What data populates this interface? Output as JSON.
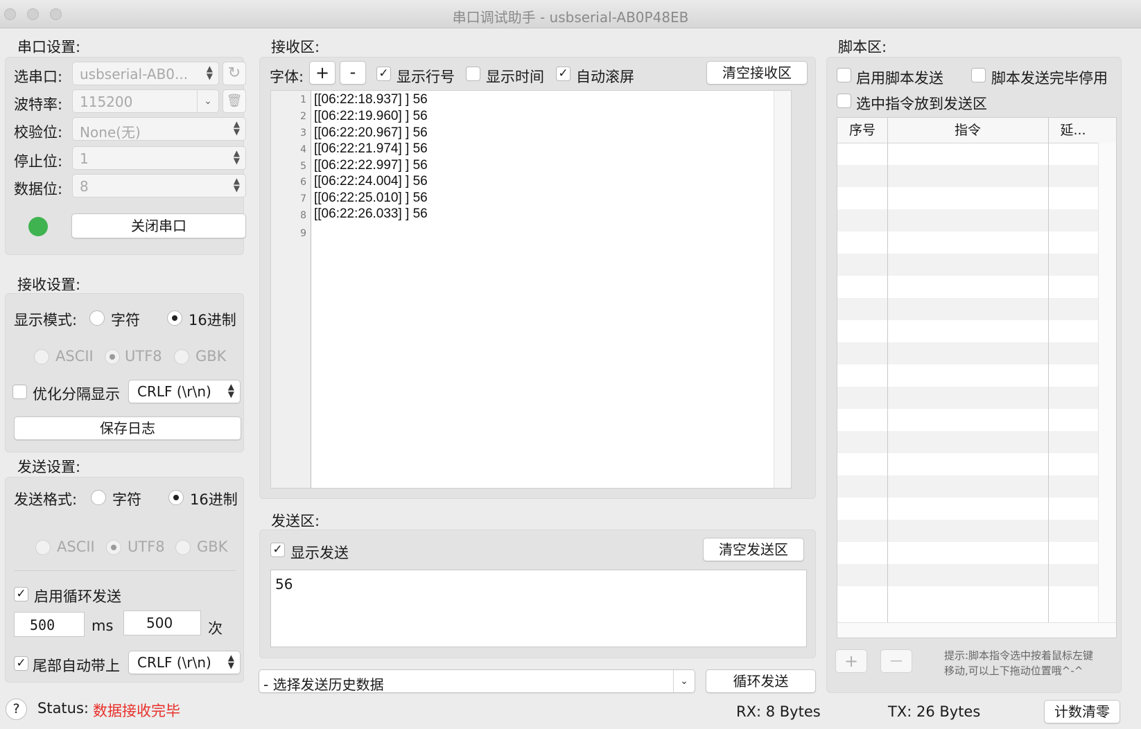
{
  "window": {
    "title": "串口调试助手 - usbserial-AB0P48EB"
  },
  "port_settings": {
    "title": "串口设置:",
    "port_label": "选串口:",
    "port_value": "usbserial-AB0...",
    "baud_label": "波特率:",
    "baud_value": "115200",
    "parity_label": "校验位:",
    "parity_value": "None(无)",
    "stopbits_label": "停止位:",
    "stopbits_value": "1",
    "databits_label": "数据位:",
    "databits_value": "8",
    "status_color": "#3fb34f",
    "close_button": "关闭串口"
  },
  "receive_settings": {
    "title": "接收设置:",
    "display_mode_label": "显示模式:",
    "mode_char": "字符",
    "mode_hex": "16进制",
    "enc_ascii": "ASCII",
    "enc_utf8": "UTF8",
    "enc_gbk": "GBK",
    "split_label": "优化分隔显示",
    "split_value": "CRLF (\\r\\n)",
    "save_log_button": "保存日志"
  },
  "send_settings": {
    "title": "发送设置:",
    "format_label": "发送格式:",
    "mode_char": "字符",
    "mode_hex": "16进制",
    "enc_ascii": "ASCII",
    "enc_utf8": "UTF8",
    "enc_gbk": "GBK",
    "loop_label": "启用循环发送",
    "interval_value": "500",
    "interval_unit": "ms",
    "count_value": "500",
    "count_unit": "次",
    "tail_label": "尾部自动带上",
    "tail_value": "CRLF (\\r\\n)"
  },
  "receive_area": {
    "title": "接收区:",
    "font_label": "字体:",
    "font_plus": "+",
    "font_minus": "-",
    "show_line_numbers": "显示行号",
    "show_time": "显示时间",
    "auto_scroll": "自动滚屏",
    "clear_button": "清空接收区",
    "line_numbers": [
      "1",
      "2",
      "3",
      "4",
      "5",
      "6",
      "7",
      "8",
      "9"
    ],
    "lines": [
      "[[06:22:18.937] ] 56",
      "[[06:22:19.960] ] 56",
      "[[06:22:20.967] ] 56",
      "[[06:22:21.974] ] 56",
      "[[06:22:22.997] ] 56",
      "[[06:22:24.004] ] 56",
      "[[06:22:25.010] ] 56",
      "[[06:22:26.033] ] 56"
    ]
  },
  "send_area": {
    "title": "发送区:",
    "show_send": "显示发送",
    "clear_button": "清空发送区",
    "content": "56",
    "history_placeholder": "- 选择发送历史数据",
    "loop_send_button": "循环发送"
  },
  "script_area": {
    "title": "脚本区:",
    "enable_script": "启用脚本发送",
    "stop_after": "脚本发送完毕停用",
    "put_selected": "选中指令放到发送区",
    "col_index": "序号",
    "col_command": "指令",
    "col_delay": "延...",
    "add": "+",
    "remove": "—",
    "hint_line1": "提示:脚本指令选中按着鼠标左键",
    "hint_line2": "移动,可以上下拖动位置哦^-^"
  },
  "statusbar": {
    "help": "?",
    "status_label": "Status:",
    "status_value": "数据接收完毕",
    "status_color": "#e8302a",
    "rx": "RX:  8 Bytes",
    "tx": "TX: 26 Bytes",
    "reset_button": "计数清零"
  }
}
